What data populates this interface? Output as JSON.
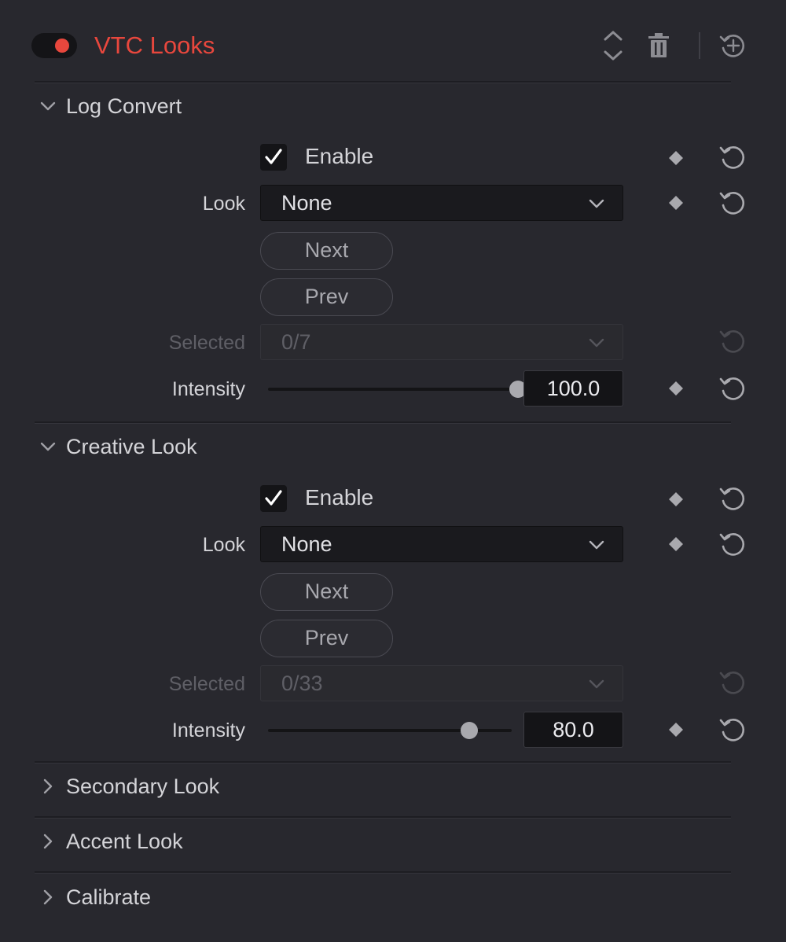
{
  "colors": {
    "background": "#28282e",
    "accent": "#e8473d",
    "text": "#d4d4d8",
    "disabled_text": "#5f5f66"
  },
  "header": {
    "title": "VTC Looks",
    "enabled": true,
    "icons": [
      "toggle-switch",
      "reorder-arrows-icon",
      "trash-icon",
      "reset-add-icon"
    ]
  },
  "sections": [
    {
      "title": "Log Convert",
      "expanded": true,
      "enable_label": "Enable",
      "enable_checked": true,
      "look_label": "Look",
      "look_value": "None",
      "next_label": "Next",
      "prev_label": "Prev",
      "selected_label": "Selected",
      "selected_value": "0/7",
      "intensity_label": "Intensity",
      "intensity_value": "100.0",
      "intensity_fraction": 1.0
    },
    {
      "title": "Creative Look",
      "expanded": true,
      "enable_label": "Enable",
      "enable_checked": true,
      "look_label": "Look",
      "look_value": "None",
      "next_label": "Next",
      "prev_label": "Prev",
      "selected_label": "Selected",
      "selected_value": "0/33",
      "intensity_label": "Intensity",
      "intensity_value": "80.0",
      "intensity_fraction": 0.8
    },
    {
      "title": "Secondary Look",
      "expanded": false
    },
    {
      "title": "Accent Look",
      "expanded": false
    },
    {
      "title": "Calibrate",
      "expanded": false
    }
  ]
}
